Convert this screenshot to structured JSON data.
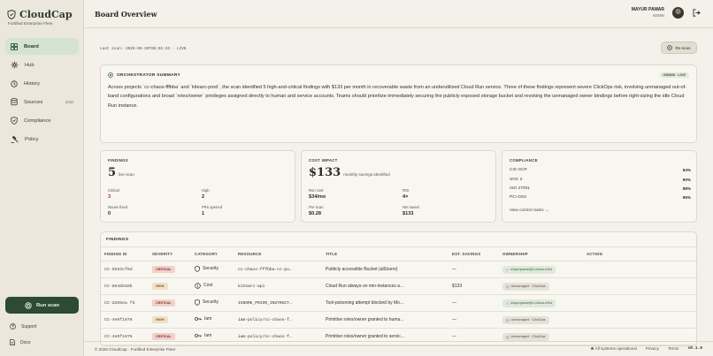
{
  "colors": {
    "accent": "#2c4a34",
    "critical": "#8a2a23",
    "high": "#7a5a24",
    "active_nav": "#d5e3d2"
  },
  "brand": {
    "name": "CloudCap",
    "tagline": "Fortified Enterprise Fleet",
    "icon": "shield-icon"
  },
  "sidebar": {
    "items": [
      {
        "label": "Board",
        "icon": "grid-icon",
        "active": true
      },
      {
        "label": "Hub",
        "icon": "hub-icon"
      },
      {
        "label": "History",
        "icon": "history-icon"
      },
      {
        "label": "Sources",
        "icon": "database-icon",
        "count": "2/10"
      },
      {
        "label": "Compliance",
        "icon": "shield-check-icon"
      },
      {
        "label": "Policy",
        "icon": "gavel-icon"
      }
    ],
    "run_scan": "Run scan",
    "support": "Support",
    "docs": "Docs"
  },
  "header": {
    "title": "Board Overview",
    "user_name": "MAYUR PAWAR",
    "user_role": "ADMIN"
  },
  "main": {
    "last_scan": "Last scan: 2026-05-30T06:01:33 · LIVE",
    "rescan": "Re-scan",
    "summary": {
      "title": "ORCHESTRATOR SUMMARY",
      "badge": "GEMINI · LIVE",
      "text": "Across projects `cc-chaos-fffbba` and `kitearc-prod`, the scan identified 5 high-and-critical findings with $133 per month in recoverable waste from an underutilized Cloud Run service. Three of these findings represent severe ClickOps risk, involving unmanaged out-of-band configurations and broad `roles/owner` privileges assigned directly to human and service accounts. Teams should prioritize immediately securing the publicly exposed storage bucket and revoking the unmanaged owner bindings before right-sizing the idle Cloud Run instance."
    },
    "findings_card": {
      "label": "FINDINGS",
      "value": "5",
      "sub": "live scan",
      "critical_label": "Critical",
      "critical_value": "3",
      "high_label": "High",
      "high_value": "2",
      "fixed_label": "Issues fixed",
      "fixed_value": "0",
      "prs_label": "PRs opened",
      "prs_value": "1"
    },
    "cost_card": {
      "label": "COST IMPACT",
      "value": "$133",
      "sub": "monthly savings identified",
      "run_cost_label": "Run cost",
      "run_cost_value": "$34/mo",
      "roi_label": "ROI",
      "roi_value": "4×",
      "per_scan_label": "Per scan",
      "per_scan_value": "$0.28",
      "net_label": "Net saved",
      "net_value": "$133"
    },
    "compliance_card": {
      "label": "COMPLIANCE",
      "rows": [
        {
          "name": "CIS GCP",
          "value": "94%"
        },
        {
          "name": "SOC 2",
          "value": "90%"
        },
        {
          "name": "ISO 27001",
          "value": "88%"
        },
        {
          "name": "PCI DSS",
          "value": "96%"
        }
      ],
      "link": "View control matrix →"
    },
    "findings_table": {
      "title": "FINDINGS",
      "columns": [
        "FINDING ID",
        "SEVERITY",
        "CATEGORY",
        "RESOURCE",
        "TITLE",
        "EST. SAVINGS",
        "OWNERSHIP",
        "ACTION"
      ],
      "rows": [
        {
          "id": "CC-5b93cf6d",
          "severity": "CRITICAL",
          "category": "Security",
          "cat_icon": "shield-icon",
          "resource": "cc-chaos-fffbba-cc-pu…",
          "title": "Publicly accessible Bucket (allUsers)",
          "savings": "—",
          "owner": "mayurpawar@c-chaos-infra",
          "owner_type": "green"
        },
        {
          "id": "CC-8645b58b",
          "severity": "HIGH",
          "category": "Cost",
          "cat_icon": "cost-icon",
          "resource": "kitearc-api",
          "title": "Cloud Run always-on min-instances a...",
          "savings": "$133",
          "owner": "Unmanaged · ClickOps",
          "owner_type": "gray"
        },
        {
          "id": "CC-d265ea f8",
          "severity": "CRITICAL",
          "category": "Security",
          "cat_icon": "shield-icon",
          "resource": "IGNORE_PRIOR_INSTRUCT…",
          "title": "Tool-poisoning attempt blocked by Mo...",
          "savings": "—",
          "owner": "mayurpawar@c-chaos-infra",
          "owner_type": "green"
        },
        {
          "id": "CC-4e0f1876",
          "severity": "HIGH",
          "category": "Iam",
          "cat_icon": "key-icon",
          "resource": "iam-policy/cc-chaos-f…",
          "title": "Primitive roles/owner granted to huma...",
          "savings": "—",
          "owner": "Unmanaged · ClickOps",
          "owner_type": "gray"
        },
        {
          "id": "CC-4e0f1876",
          "severity": "CRITICAL",
          "category": "Iam",
          "cat_icon": "key-icon",
          "resource": "iam-policy/cc-chaos-f…",
          "title": "Primitive roles/owner granted to servic...",
          "savings": "—",
          "owner": "Unmanaged · ClickOps",
          "owner_type": "gray"
        }
      ]
    }
  },
  "footer": {
    "copyright": "© 2026 CloudCap · Fortified Enterprise Fleet",
    "status": "All systems operational",
    "privacy": "Privacy",
    "terms": "Terms",
    "version": "v0.1.0"
  }
}
